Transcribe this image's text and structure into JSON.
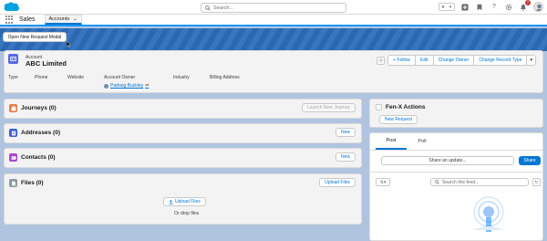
{
  "header": {
    "search_placeholder": "Search...",
    "notification_count": "7"
  },
  "nav": {
    "app_name": "Sales",
    "tab_label": "Accounts"
  },
  "page": {
    "modal_button": "Open New Request Modal"
  },
  "record": {
    "type_label": "Account",
    "name": "ABC Limited",
    "actions": [
      "+ Follow",
      "Edit",
      "Change Owner",
      "Change Record Type"
    ],
    "fields": [
      {
        "label": "Type",
        "value": ""
      },
      {
        "label": "Phone",
        "value": ""
      },
      {
        "label": "Website",
        "value": ""
      },
      {
        "label": "Account Owner",
        "value": "Padraig Buckley"
      },
      {
        "label": "Industry",
        "value": ""
      },
      {
        "label": "Billing Address",
        "value": ""
      }
    ]
  },
  "cards": {
    "journeys": {
      "title": "Journeys (0)",
      "button": "Launch New Journey"
    },
    "addresses": {
      "title": "Addresses (0)",
      "button": "New"
    },
    "contacts": {
      "title": "Contacts (0)",
      "button": "New"
    },
    "files": {
      "title": "Files (0)",
      "button": "Upload Files",
      "upload_label": "Upload Files",
      "drop_text": "Or drop files"
    }
  },
  "fenx": {
    "title": "Fen-X Actions",
    "button": "New Request"
  },
  "feed": {
    "tabs": [
      "Post",
      "Poll"
    ],
    "share_placeholder": "Share an update...",
    "share_button": "Share",
    "search_placeholder": "Search this feed..."
  },
  "colors": {
    "brand_blue": "#0176d3",
    "account_icon": "#5867e8",
    "journeys_icon": "#ea7c4d",
    "addresses_icon": "#3c5fd6",
    "contacts_icon": "#a94ac9",
    "files_icon": "#8c9ba5"
  }
}
